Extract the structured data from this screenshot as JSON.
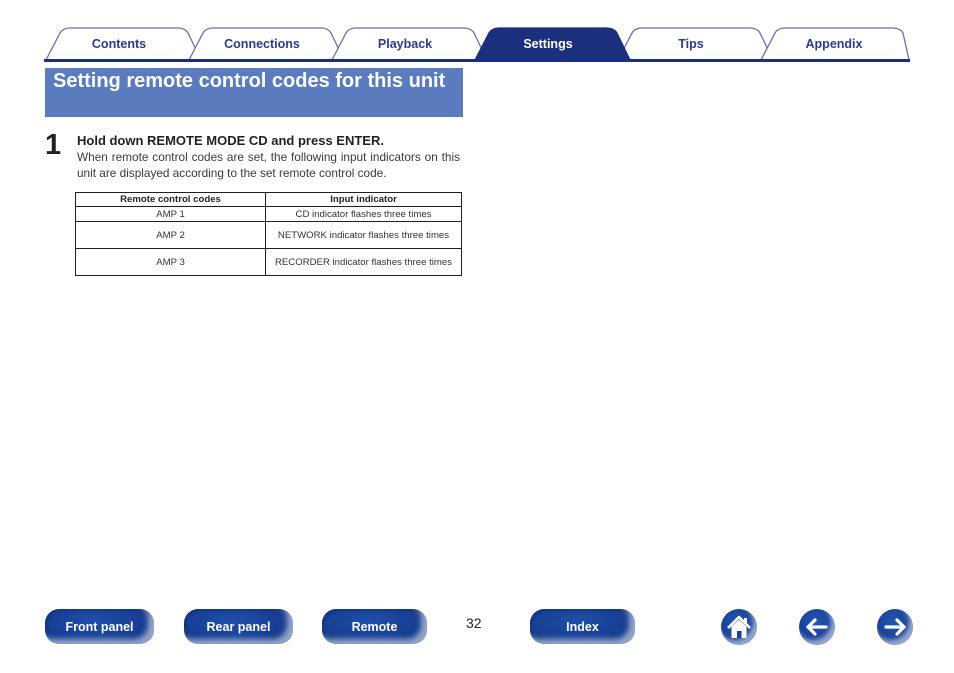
{
  "tabs": [
    {
      "label": "Contents",
      "active": false
    },
    {
      "label": "Connections",
      "active": false
    },
    {
      "label": "Playback",
      "active": false
    },
    {
      "label": "Settings",
      "active": true
    },
    {
      "label": "Tips",
      "active": false
    },
    {
      "label": "Appendix",
      "active": false
    }
  ],
  "colors": {
    "tab_active": "#1b2f7f",
    "tab_text": "#2e3a8c",
    "tab_outline": "#6a6fa6",
    "section_bg": "#5b7bbf",
    "nav_button": "#173f95"
  },
  "section": {
    "title": "Setting remote control codes for this unit"
  },
  "step": {
    "number": "1",
    "heading": "Hold down REMOTE MODE CD and press ENTER.",
    "body": "When remote control codes are set, the following input indicators on this unit are displayed according to the set remote control code."
  },
  "table": {
    "headers": [
      "Remote control codes",
      "Input indicator"
    ],
    "rows": [
      [
        "AMP 1",
        "CD indicator flashes three times"
      ],
      [
        "AMP 2",
        "NETWORK indicator flashes three times"
      ],
      [
        "AMP 3",
        "RECORDER indicator flashes three times"
      ]
    ]
  },
  "footer": {
    "buttons": [
      "Front panel",
      "Rear panel",
      "Remote",
      "Index"
    ],
    "page_number": "32",
    "icons": [
      "home-icon",
      "back-arrow-icon",
      "forward-arrow-icon"
    ]
  }
}
